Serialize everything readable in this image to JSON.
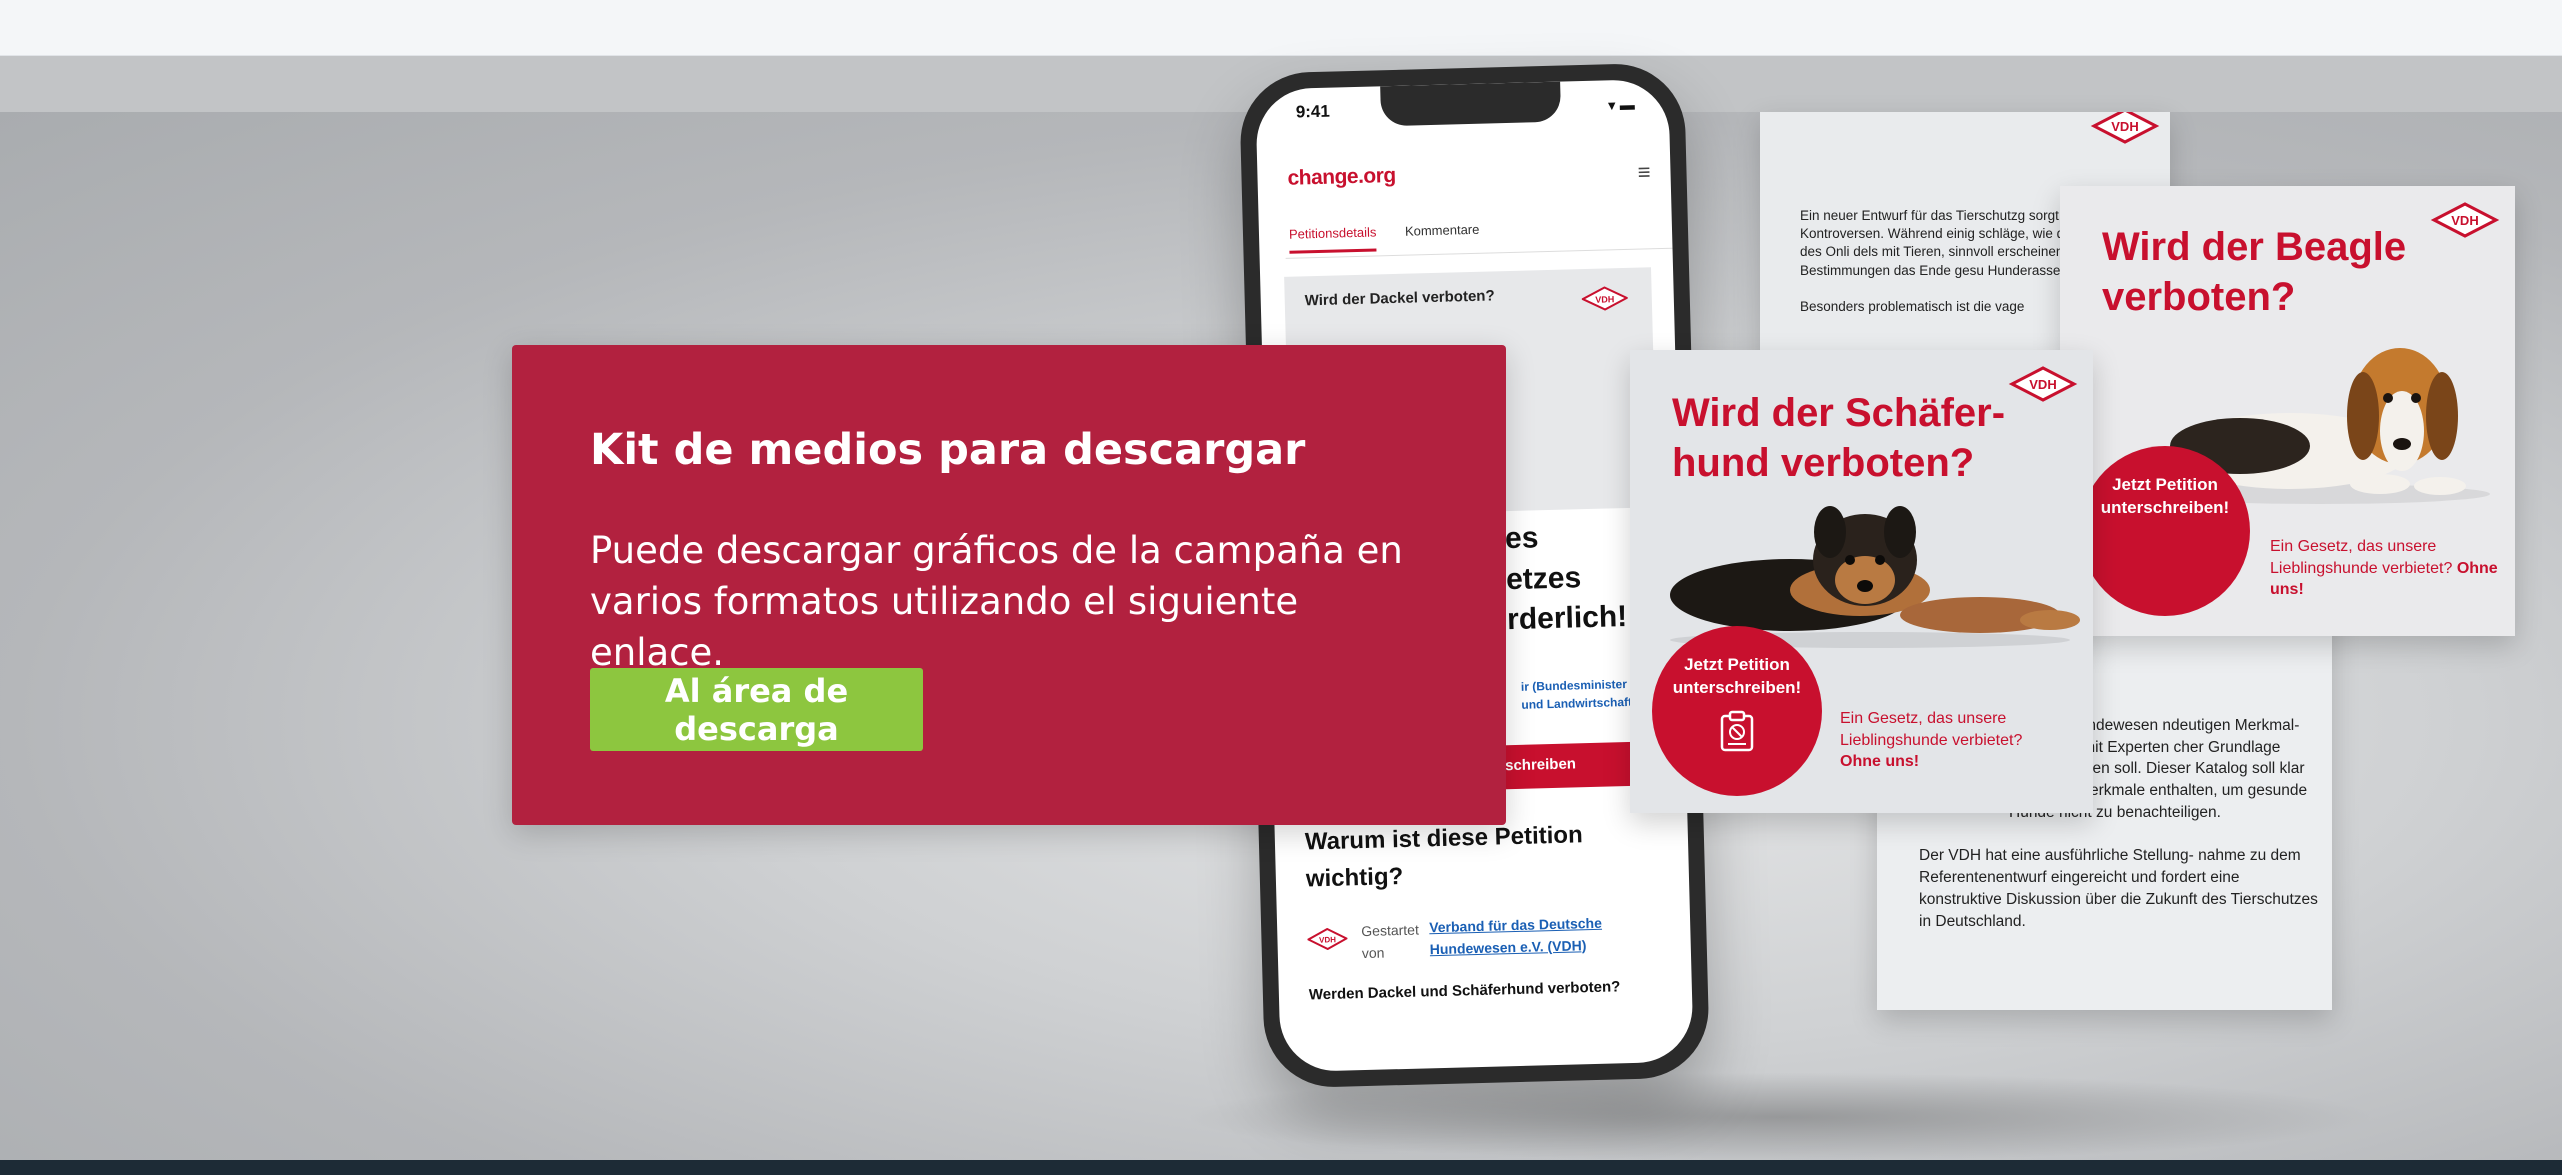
{
  "promo": {
    "title": "Kit de medios para descargar",
    "description": "Puede descargar gráficos de la campaña en varios formatos utilizando el siguiente enlace.",
    "button_label": "Al área de descarga",
    "button_color": "#8dc63f",
    "background_color": "#b2213f"
  },
  "phone": {
    "status_time": "9:41",
    "status_icons": "▾ ▬",
    "site_logo": "change.org",
    "menu_icon": "hamburger-icon",
    "tabs": [
      "Petitionsdetails",
      "Kommentare"
    ],
    "card_title": "Wird der Dackel verboten?",
    "headline_partial": "es\netzes\nrderlich!",
    "links_partial": "ir (Bundesminister\nund Landwirtschaft",
    "sign_button_partial": "schreiben",
    "why_heading": "Warum ist diese Petition wichtig?",
    "started_by_label": "Gestartet von",
    "started_by_org": "Verband für das Deutsche Hundewesen e.V. (VDH)",
    "question": "Werden Dackel und Schäferhund verboten?"
  },
  "flyers": {
    "vdh_badge": "VDH",
    "text_back": {
      "paragraph_1": "Ein neuer Entwurf für das Tierschutzg sorgt für Kontroversen. Während einig schläge, wie die Regulierung des Onli dels mit Tieren, sinnvoll erscheinen, kö andere Bestimmungen das Ende gesu Hunderassen bedeuten.",
      "paragraph_2": "Besonders problematisch ist die vage"
    },
    "beagle": {
      "title": "Wird der Beagle verboten?",
      "sign_cta": "Jetzt Petition unterschreiben!",
      "slogan": "Ein Gesetz, das unsere Lieblingshunde verbietet?",
      "slogan_strong": "Ohne uns!"
    },
    "bottom_text": {
      "paragraph_1": "eutsche Hundewesen ndeutigen Merkmal- menarbeit mit Experten cher Grundlage erstellt werden soll. Dieser Katalog soll klar definierte Merkmale enthalten, um gesunde Hunde nicht zu benachteiligen.",
      "paragraph_2": "Der VDH hat eine ausführliche Stellung- nahme zu dem Referentenentwurf eingereicht und fordert eine konstruktive Diskussion über die Zukunft des Tierschutzes in Deutschland."
    },
    "schaefer": {
      "title": "Wird der Schäfer- hund verboten?",
      "sign_cta": "Jetzt Petition unterschreiben!",
      "slogan": "Ein Gesetz, das unsere Lieblingshunde verbietet?",
      "slogan_strong": "Ohne uns!"
    }
  },
  "colors": {
    "accent_red": "#c8102e",
    "footer": "#1d2b36",
    "top_bar": "#f4f6f8"
  }
}
